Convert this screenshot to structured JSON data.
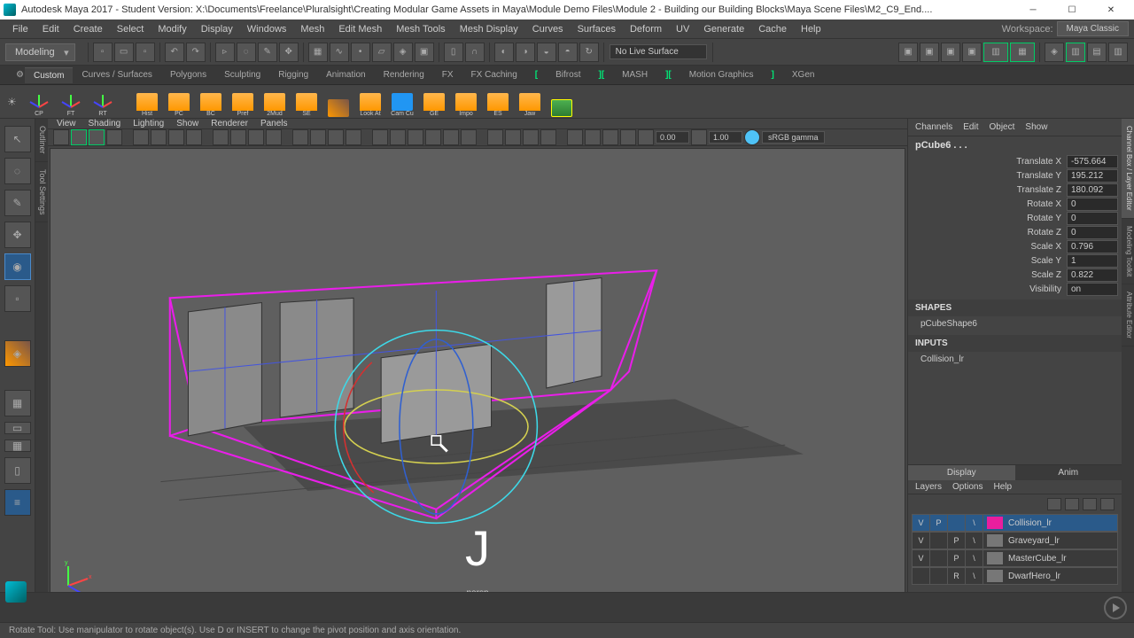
{
  "window": {
    "title": "Autodesk Maya 2017 - Student Version: X:\\Documents\\Freelance\\Pluralsight\\Creating Modular Game Assets in Maya\\Module Demo Files\\Module 2 - Building our Building Blocks\\Maya Scene Files\\M2_C9_End...."
  },
  "menu": [
    "File",
    "Edit",
    "Create",
    "Select",
    "Modify",
    "Display",
    "Windows",
    "Mesh",
    "Edit Mesh",
    "Mesh Tools",
    "Mesh Display",
    "Curves",
    "Surfaces",
    "Deform",
    "UV",
    "Generate",
    "Cache",
    "Help"
  ],
  "workspace": {
    "label": "Workspace:",
    "value": "Maya Classic"
  },
  "moduleDropdown": "Modeling",
  "liveSurface": "No Live Surface",
  "shelfTabs": [
    "Custom",
    "Curves / Surfaces",
    "Polygons",
    "Sculpting",
    "Rigging",
    "Animation",
    "Rendering",
    "FX",
    "FX Caching"
  ],
  "shelfExtras": [
    "Bifrost",
    "MASH",
    "Motion Graphics",
    "XGen"
  ],
  "shelfItems": [
    "CP",
    "FT",
    "RT",
    "Hist",
    "PC",
    "BC",
    "Pref",
    "2Mud",
    "SE",
    "",
    "Look At",
    "Cam Cu",
    "GE",
    "Impo",
    "ES",
    "Jaw",
    ""
  ],
  "sideTabs": [
    "Outliner",
    "Tool Settings"
  ],
  "viewportMenu": [
    "View",
    "Shading",
    "Lighting",
    "Show",
    "Renderer",
    "Panels"
  ],
  "viewportFields": {
    "f1": "0.00",
    "f2": "1.00",
    "gamma": "sRGB gamma"
  },
  "viewport": {
    "camera": "persp",
    "key": "J"
  },
  "channelMenu": [
    "Channels",
    "Edit",
    "Object",
    "Show"
  ],
  "objectName": "pCube6 . . .",
  "channels": [
    {
      "label": "Translate X",
      "value": "-575.664"
    },
    {
      "label": "Translate Y",
      "value": "195.212"
    },
    {
      "label": "Translate Z",
      "value": "180.092"
    },
    {
      "label": "Rotate X",
      "value": "0"
    },
    {
      "label": "Rotate Y",
      "value": "0"
    },
    {
      "label": "Rotate Z",
      "value": "0"
    },
    {
      "label": "Scale X",
      "value": "0.796"
    },
    {
      "label": "Scale Y",
      "value": "1"
    },
    {
      "label": "Scale Z",
      "value": "0.822"
    },
    {
      "label": "Visibility",
      "value": "on"
    }
  ],
  "shapesHeader": "SHAPES",
  "shapeName": "pCubeShape6",
  "inputsHeader": "INPUTS",
  "inputName": "Collision_lr",
  "layerTabs": [
    "Display",
    "Anim"
  ],
  "layerMenu": [
    "Layers",
    "Options",
    "Help"
  ],
  "layers": [
    {
      "v": "V",
      "col2": "P",
      "col3": "",
      "swatch": "#e91e9e",
      "name": "Collision_lr",
      "sel": true
    },
    {
      "v": "V",
      "col2": "",
      "col3": "P",
      "swatch": "#777",
      "name": "Graveyard_lr",
      "sel": false
    },
    {
      "v": "V",
      "col2": "",
      "col3": "P",
      "swatch": "#777",
      "name": "MasterCube_lr",
      "sel": false
    },
    {
      "v": "",
      "col2": "",
      "col3": "R",
      "swatch": "#777",
      "name": "DwarfHero_lr",
      "sel": false
    }
  ],
  "rightTabs": [
    "Channel Box / Layer Editor",
    "Modeling Toolkit",
    "Attribute Editor"
  ],
  "status": "Rotate Tool: Use manipulator to rotate object(s). Use D or INSERT to change the pivot position and axis orientation."
}
